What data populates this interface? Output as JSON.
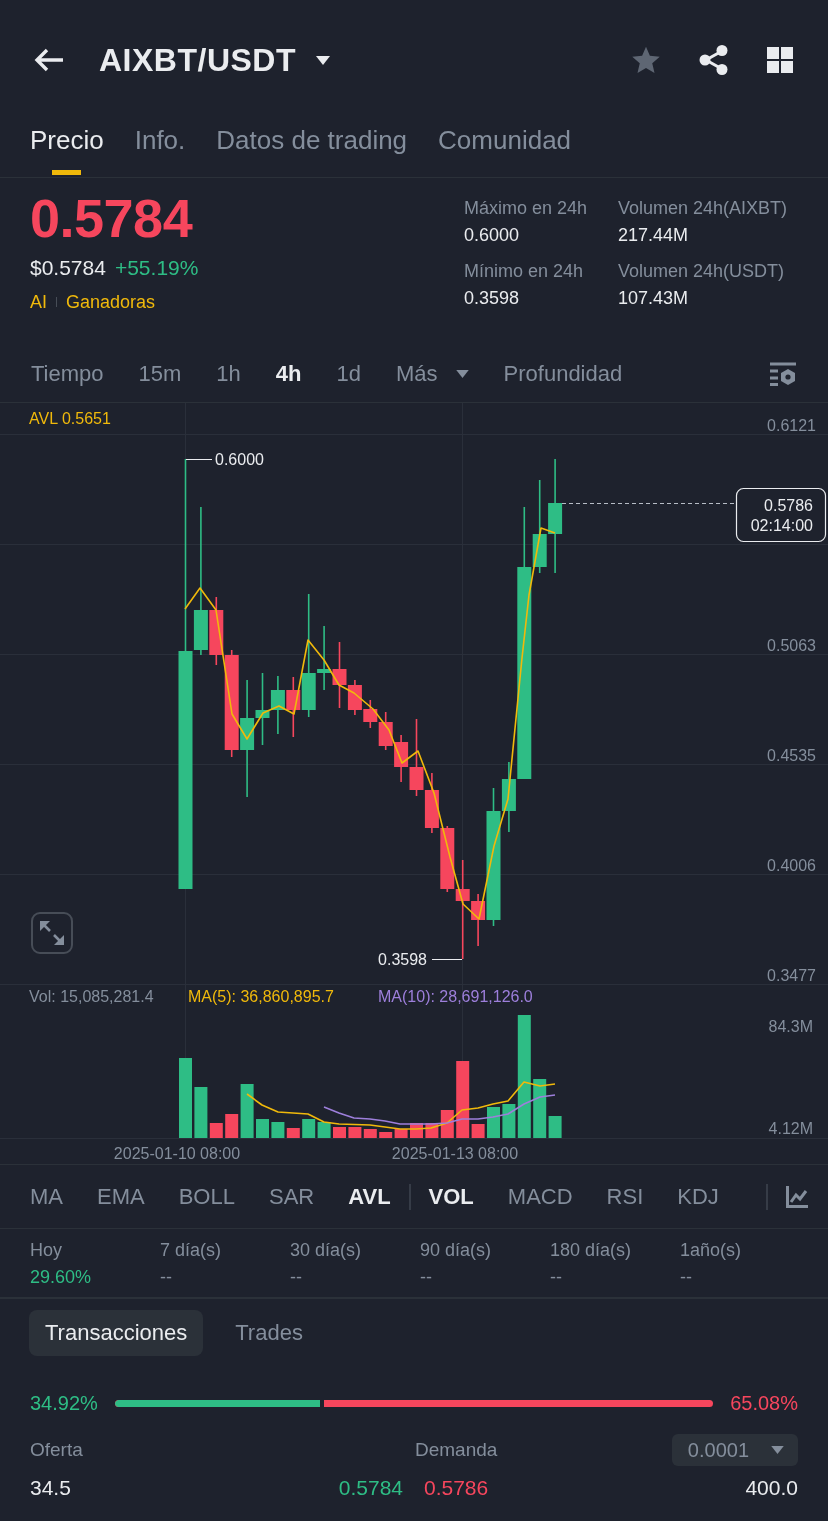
{
  "header": {
    "title": "AIXBT/USDT",
    "favorited": false
  },
  "tabs": [
    {
      "label": "Precio",
      "selected": true
    },
    {
      "label": "Info.",
      "selected": false
    },
    {
      "label": "Datos de trading",
      "selected": false
    },
    {
      "label": "Comunidad",
      "selected": false
    }
  ],
  "ticker": {
    "last_price": "0.5784",
    "price_rising": false,
    "fiat_price": "$0.5784",
    "change": "+55.19%",
    "change_rising": true,
    "tags": [
      "AI",
      "Ganadoras"
    ],
    "stats": [
      {
        "label": "Máximo en 24h",
        "value": "0.6000"
      },
      {
        "label": "Volumen 24h(AIXBT)",
        "value": "217.44M"
      },
      {
        "label": "Mínimo en 24h",
        "value": "0.3598"
      },
      {
        "label": "Volumen 24h(USDT)",
        "value": "107.43M"
      }
    ]
  },
  "intervals": [
    {
      "label": "Tiempo",
      "kind": "option",
      "selected": false
    },
    {
      "label": "15m",
      "kind": "option",
      "selected": false
    },
    {
      "label": "1h",
      "kind": "option",
      "selected": false
    },
    {
      "label": "4h",
      "kind": "option",
      "selected": true
    },
    {
      "label": "1d",
      "kind": "option",
      "selected": false
    },
    {
      "label": "Más",
      "kind": "menu",
      "selected": false
    },
    {
      "label": "Profundidad",
      "kind": "option",
      "selected": false
    }
  ],
  "chart": {
    "avl_label": "AVL 0.5651",
    "price_ticks": [
      "0.6121",
      "0.5063",
      "0.4535",
      "0.4006",
      "0.3477"
    ],
    "high_label": "0.6000",
    "low_label": "0.3598",
    "last_price": "0.5786",
    "countdown": "02:14:00",
    "volume_label": "Vol: 15,085,281.4",
    "ma5_label": "MA(5): 36,860,895.7",
    "ma10_label": "MA(10): 28,691,126.0",
    "volume_ticks": [
      "84.3M",
      "4.12M"
    ],
    "dates": [
      "2025-01-10 08:00",
      "2025-01-13 08:00"
    ]
  },
  "main_indicators": [
    {
      "label": "MA",
      "selected": false
    },
    {
      "label": "EMA",
      "selected": false
    },
    {
      "label": "BOLL",
      "selected": false
    },
    {
      "label": "SAR",
      "selected": false
    },
    {
      "label": "AVL",
      "selected": true
    }
  ],
  "sub_indicators": [
    {
      "label": "VOL",
      "selected": true
    },
    {
      "label": "MACD",
      "selected": false
    },
    {
      "label": "RSI",
      "selected": false
    },
    {
      "label": "KDJ",
      "selected": false
    }
  ],
  "avl_stats": [
    {
      "label": "Hoy",
      "value": "29.60%",
      "color": "#2ebd85"
    },
    {
      "label": "7 día(s)",
      "value": "--",
      "color": "#848e9c"
    },
    {
      "label": "30 día(s)",
      "value": "--",
      "color": "#848e9c"
    },
    {
      "label": "90 día(s)",
      "value": "--",
      "color": "#848e9c"
    },
    {
      "label": "180 día(s)",
      "value": "--",
      "color": "#848e9c"
    },
    {
      "label": "1año(s)",
      "value": "--",
      "color": "#848e9c"
    }
  ],
  "book_tabs": [
    {
      "label": "Transacciones",
      "selected": true
    },
    {
      "label": "Trades",
      "selected": false
    }
  ],
  "ratio": {
    "buy_label": "34.92%",
    "sell_label": "65.08%",
    "level": 0.3492
  },
  "order_book": {
    "bid_header": "Oferta",
    "ask_header": "Demanda",
    "precision": "0.0001",
    "rows": [
      {
        "bid_qty": "34.5",
        "bid_price": "0.5784",
        "ask_price": "0.5786",
        "ask_qty": "400.0"
      }
    ]
  }
}
